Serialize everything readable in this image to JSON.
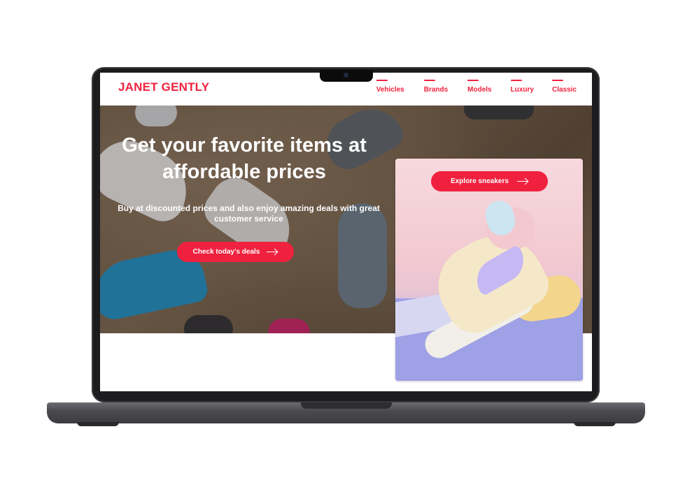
{
  "brand": {
    "logo_text": "JANET GENTLY",
    "accent_color": "#f0213f"
  },
  "nav": {
    "items": [
      {
        "label": "Vehicles"
      },
      {
        "label": "Brands"
      },
      {
        "label": "Models"
      },
      {
        "label": "Luxury"
      },
      {
        "label": "Classic"
      }
    ]
  },
  "hero": {
    "title": "Get your favorite items at affordable prices",
    "subtitle": "Buy at discounted prices and also enjoy amazing deals with great customer service",
    "cta_label": "Check today's deals",
    "cta_icon": "arrow-right-icon"
  },
  "product_card": {
    "button_label": "Explore sneakers",
    "button_icon": "arrow-right-icon"
  }
}
